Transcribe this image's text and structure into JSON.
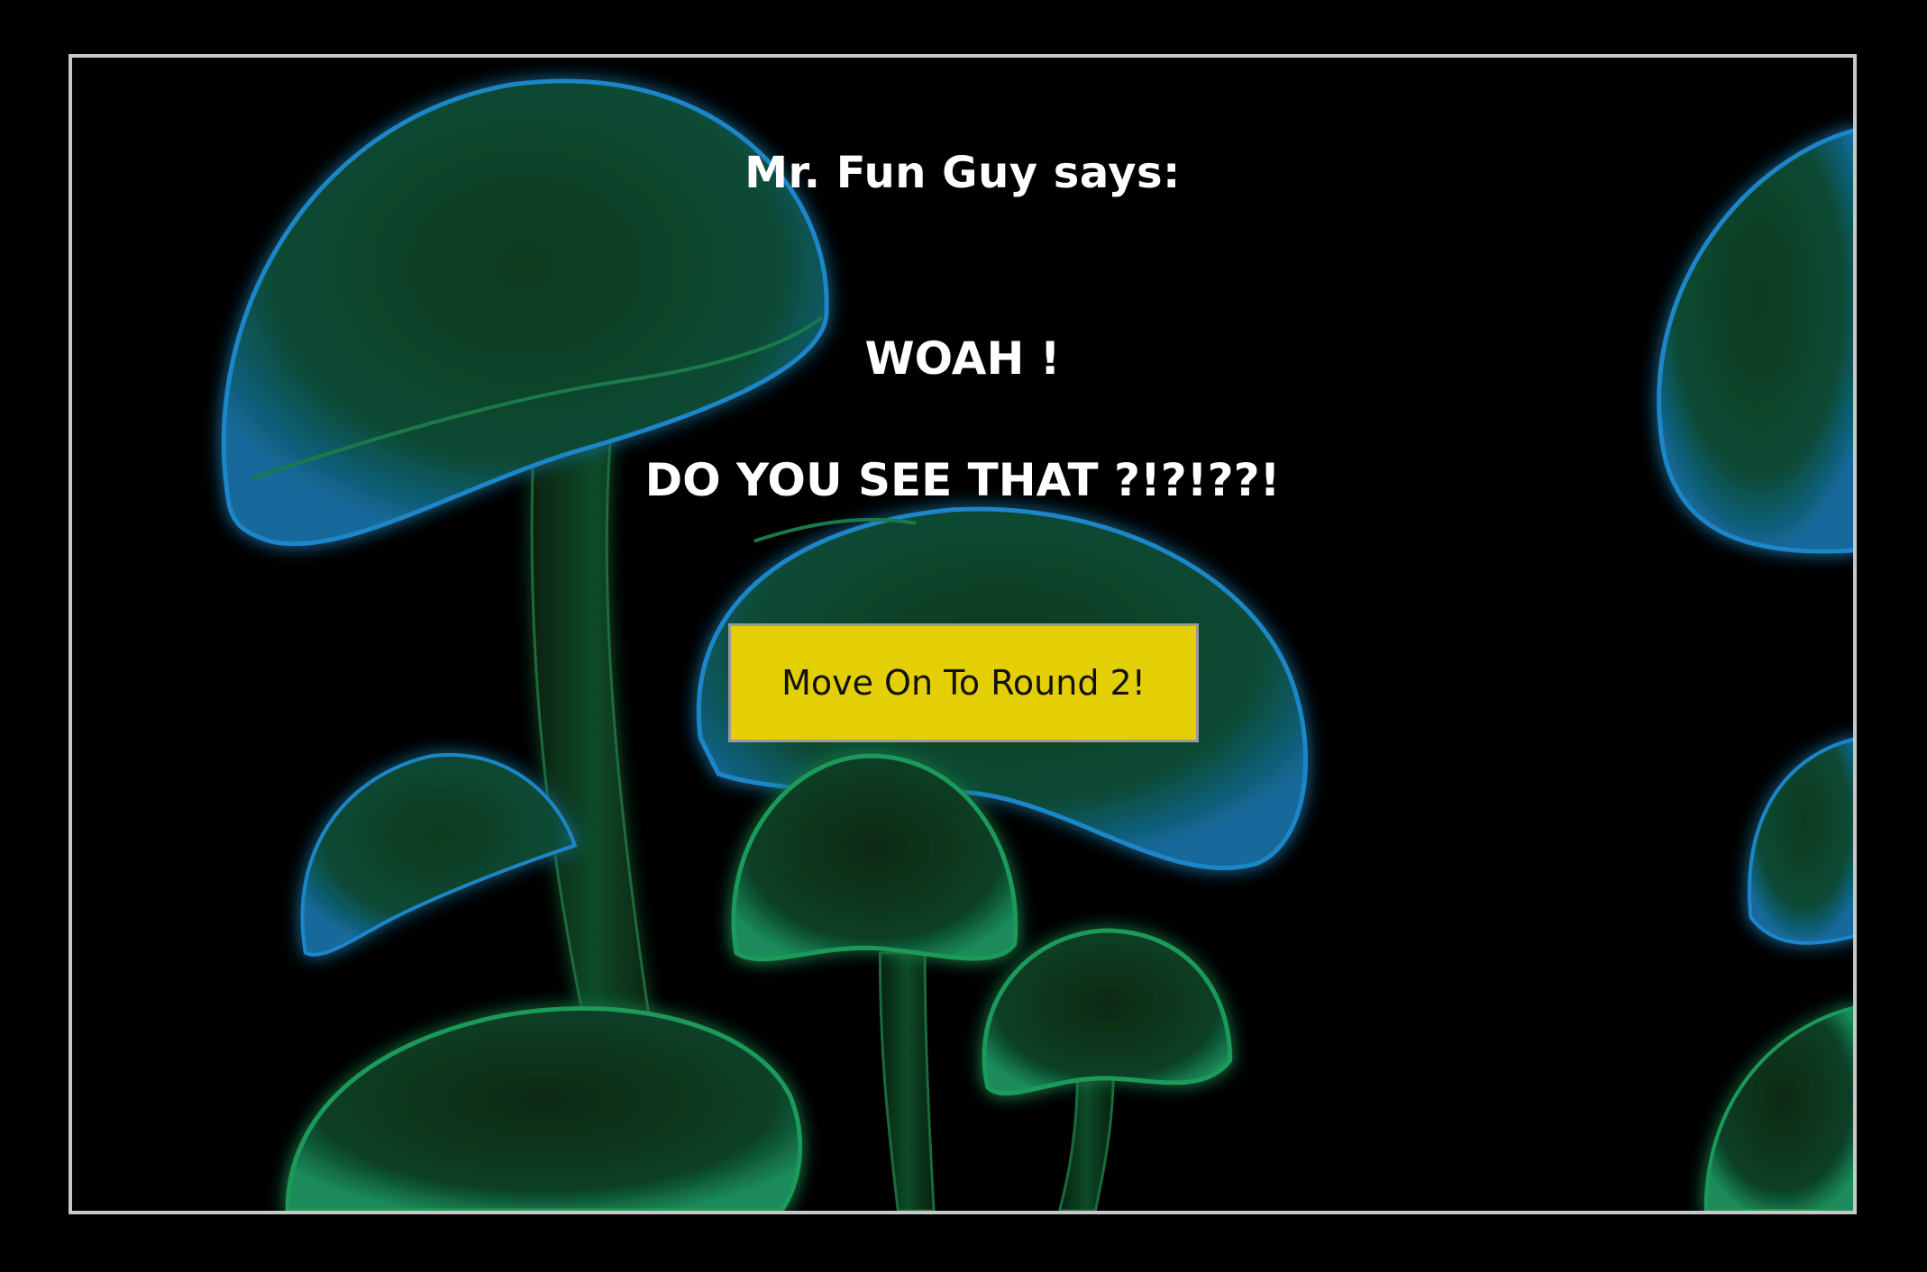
{
  "dialog": {
    "speaker": "Mr. Fun Guy says:",
    "line1": "WOAH !",
    "line2": "DO YOU SEE THAT ?!?!??!"
  },
  "actions": {
    "next_round_label": "Move On To Round 2!"
  },
  "background": {
    "icon": "glowing-mushrooms-illustration"
  },
  "colors": {
    "page_background": "#000000",
    "frame_border": "#c8c8c8",
    "text": "#ffffff",
    "button_fill": "#e4cf06",
    "button_text": "#111111",
    "mushroom_glow_blue": "#1a7fd0",
    "mushroom_glow_green": "#1faa5a"
  }
}
